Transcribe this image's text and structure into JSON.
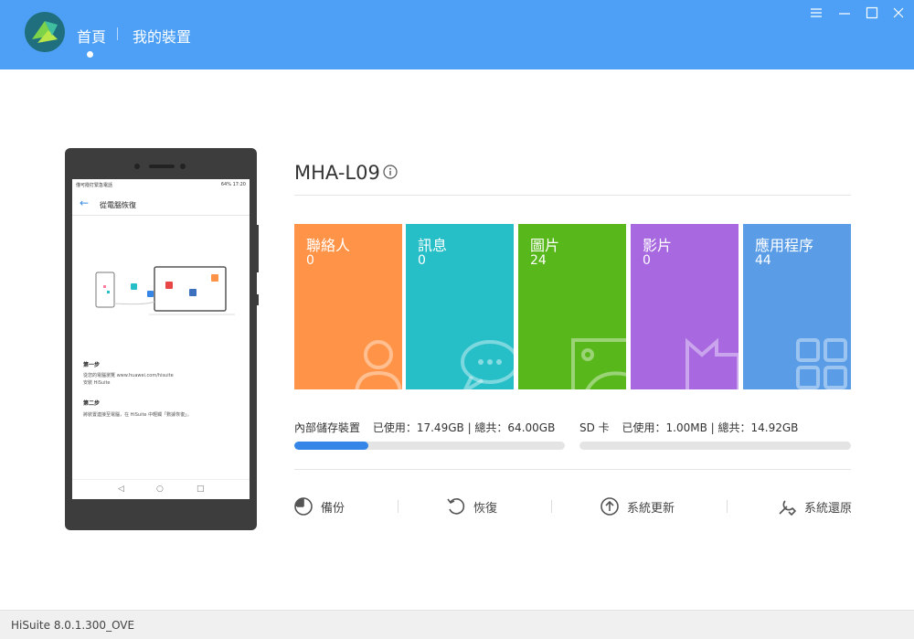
{
  "header": {
    "nav_home": "首頁",
    "nav_device": "我的裝置",
    "bg_color": "#4da0f5"
  },
  "phone": {
    "status_left": "僅可撥打緊急電話",
    "status_right": "64% 17:20",
    "title": "從電腦恢復",
    "step1_title": "第一步",
    "step1_text1": "從您的電腦瀏覽 www.huawei.com/hisuite",
    "step1_text2": "安裝 HiSuite",
    "step2_title": "第二步",
    "step2_text": "將裝置連接至電腦，在 HiSuite 中輕觸「數據恢復」。"
  },
  "device": {
    "name": "MHA-L09"
  },
  "tiles": [
    {
      "label": "聯絡人",
      "count": "0",
      "color": "#ff9448",
      "icon": "contact-icon"
    },
    {
      "label": "訊息",
      "count": "0",
      "color": "#26bfc8",
      "icon": "message-icon"
    },
    {
      "label": "圖片",
      "count": "24",
      "color": "#58b81b",
      "icon": "image-icon"
    },
    {
      "label": "影片",
      "count": "0",
      "color": "#a768e0",
      "icon": "video-icon"
    },
    {
      "label": "應用程序",
      "count": "44",
      "color": "#5a9de6",
      "icon": "apps-icon"
    }
  ],
  "storage": {
    "internal": {
      "label": "內部儲存裝置",
      "used": "已使用：17.49GB",
      "total": "總共：64.00GB",
      "used_fraction": 0.273
    },
    "sd": {
      "label": "SD 卡",
      "used": "已使用：1.00MB",
      "total": "總共：14.92GB",
      "used_fraction": 0.0
    }
  },
  "actions": [
    {
      "label": "備份",
      "icon": "backup-icon"
    },
    {
      "label": "恢復",
      "icon": "restore-icon"
    },
    {
      "label": "系統更新",
      "icon": "system-update-icon"
    },
    {
      "label": "系統還原",
      "icon": "system-restore-icon"
    }
  ],
  "footer": {
    "version": "HiSuite 8.0.1.300_OVE"
  }
}
